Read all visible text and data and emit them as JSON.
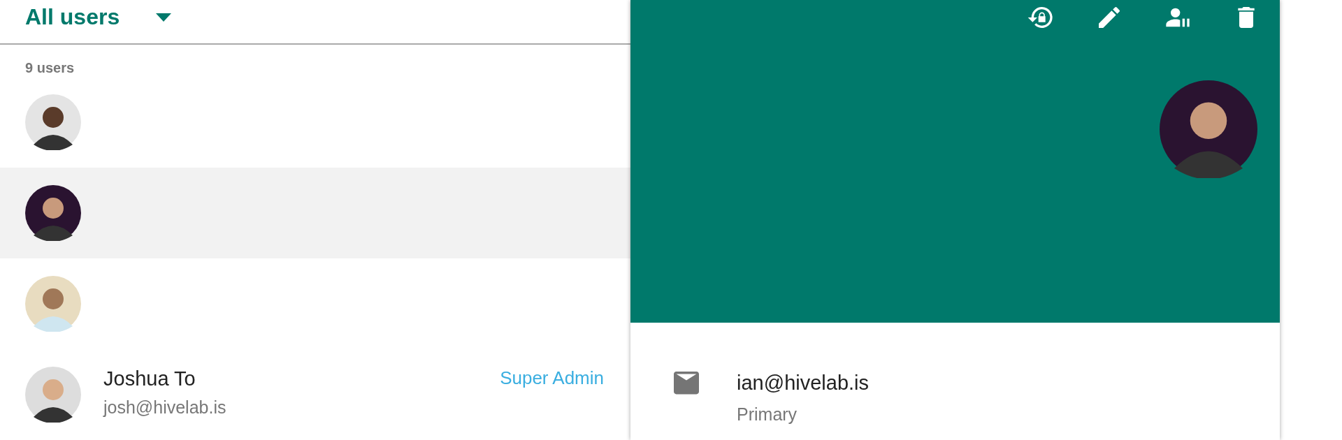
{
  "filter": {
    "label": "All users"
  },
  "user_count": "9 users",
  "users": [
    {
      "selected": false
    },
    {
      "selected": true
    },
    {
      "selected": false
    },
    {
      "selected": false,
      "name": "Joshua To",
      "email": "josh@hivelab.is",
      "role": "Super Admin"
    }
  ],
  "detail": {
    "email": "ian@hivelab.is",
    "email_type": "Primary"
  }
}
